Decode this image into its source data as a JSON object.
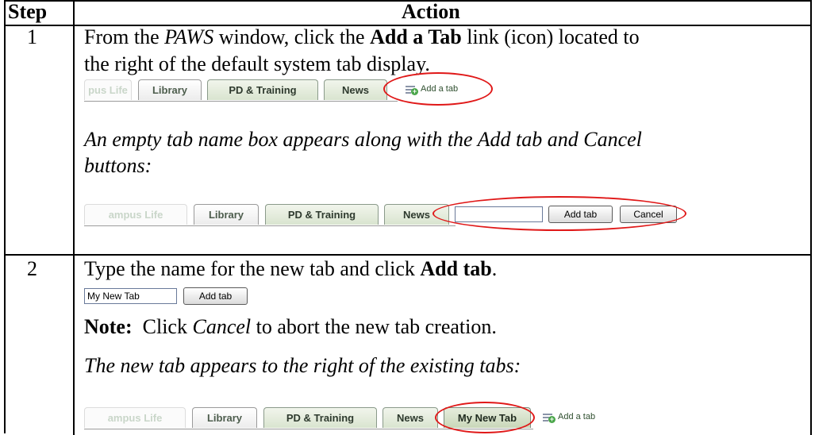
{
  "headers": {
    "step": "Step",
    "action": "Action"
  },
  "rows": [
    {
      "step": "1",
      "instr_a": "From the ",
      "instr_b": "PAWS",
      "instr_c": " window, click the ",
      "instr_d": "Add a Tab",
      "instr_e": " link (icon) located to",
      "instr_line2": "the right of the default system tab display.",
      "result_line1": "An empty tab name box appears along with the Add tab and Cancel",
      "result_line2": "buttons:"
    },
    {
      "step": "2",
      "instr_a": "Type the name for the new tab and click ",
      "instr_b": "Add tab",
      "instr_c": ".",
      "note_label": "Note:",
      "note_a": "  Click ",
      "note_b": "Cancel",
      "note_c": " to abort the new tab creation.",
      "result": "The new tab appears to the right of the existing tabs:"
    }
  ],
  "tabs": {
    "campus_life": "Campus Life",
    "campus_life_clipped": "pus Life",
    "campus_life_partial": "ampus Life",
    "library": "Library",
    "pd_training": "PD & Training",
    "news": "News",
    "add_a_tab": "Add a tab",
    "my_new_tab": "My New Tab"
  },
  "controls": {
    "add_tab_button": "Add tab",
    "cancel_button": "Cancel",
    "tab_name_value": "My New Tab"
  },
  "colors": {
    "highlight": "#e01818"
  }
}
